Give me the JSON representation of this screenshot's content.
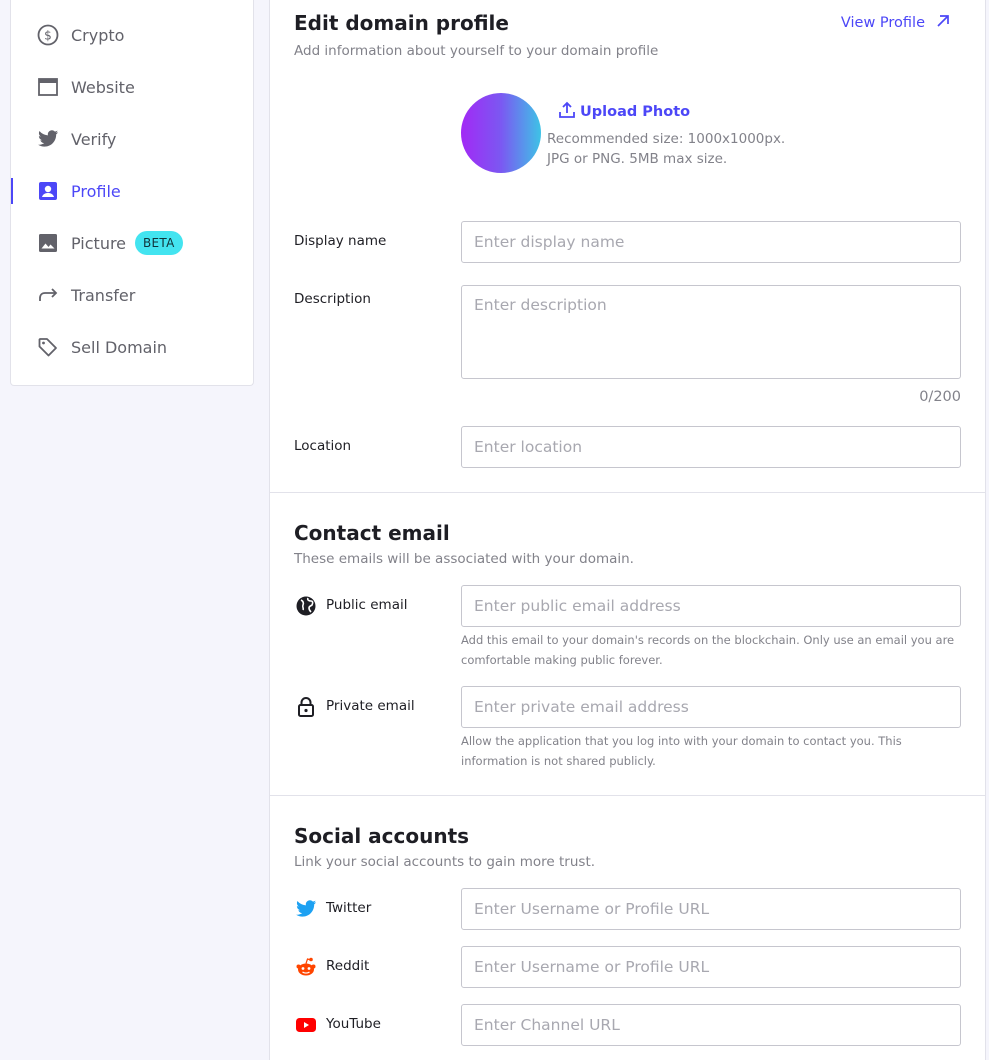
{
  "sidebar": {
    "items": [
      {
        "label": "Crypto",
        "icon": "dollar-circle-icon",
        "active": false
      },
      {
        "label": "Website",
        "icon": "browser-window-icon",
        "active": false
      },
      {
        "label": "Verify",
        "icon": "twitter-icon",
        "active": false
      },
      {
        "label": "Profile",
        "icon": "person-badge-icon",
        "active": true
      },
      {
        "label": "Picture",
        "icon": "image-icon",
        "active": false,
        "badge": "BETA"
      },
      {
        "label": "Transfer",
        "icon": "forward-arrow-icon",
        "active": false
      },
      {
        "label": "Sell Domain",
        "icon": "price-tag-icon",
        "active": false
      }
    ]
  },
  "profile": {
    "title": "Edit domain profile",
    "subtitle": "Add information about yourself to your domain profile",
    "view_profile": "View Profile",
    "upload_photo": "Upload Photo",
    "recommended_line1": "Recommended size: 1000x1000px.",
    "recommended_line2": "JPG or PNG. 5MB max size.",
    "display_name_label": "Display name",
    "display_name_placeholder": "Enter display name",
    "description_label": "Description",
    "description_placeholder": "Enter description",
    "description_counter": "0/200",
    "location_label": "Location",
    "location_placeholder": "Enter location"
  },
  "contact": {
    "title": "Contact email",
    "subtitle": "These emails will be associated with your domain.",
    "public_label": "Public email",
    "public_placeholder": "Enter public email address",
    "public_hint": "Add this email to your domain's records on the blockchain. Only use an email you are comfortable making public forever.",
    "private_label": "Private email",
    "private_placeholder": "Enter private email address",
    "private_hint": "Allow the application that you log into with your domain to contact you. This information is not shared publicly."
  },
  "social": {
    "title": "Social accounts",
    "subtitle": "Link your social accounts to gain more trust.",
    "twitter_label": "Twitter",
    "twitter_placeholder": "Enter Username or Profile URL",
    "reddit_label": "Reddit",
    "reddit_placeholder": "Enter Username or Profile URL",
    "youtube_label": "YouTube",
    "youtube_placeholder": "Enter Channel URL"
  },
  "colors": {
    "accent": "#4c47f7",
    "beta_badge": "#43e4f0",
    "twitter": "#1da1f2",
    "reddit": "#ff4500",
    "youtube": "#ff0000"
  }
}
